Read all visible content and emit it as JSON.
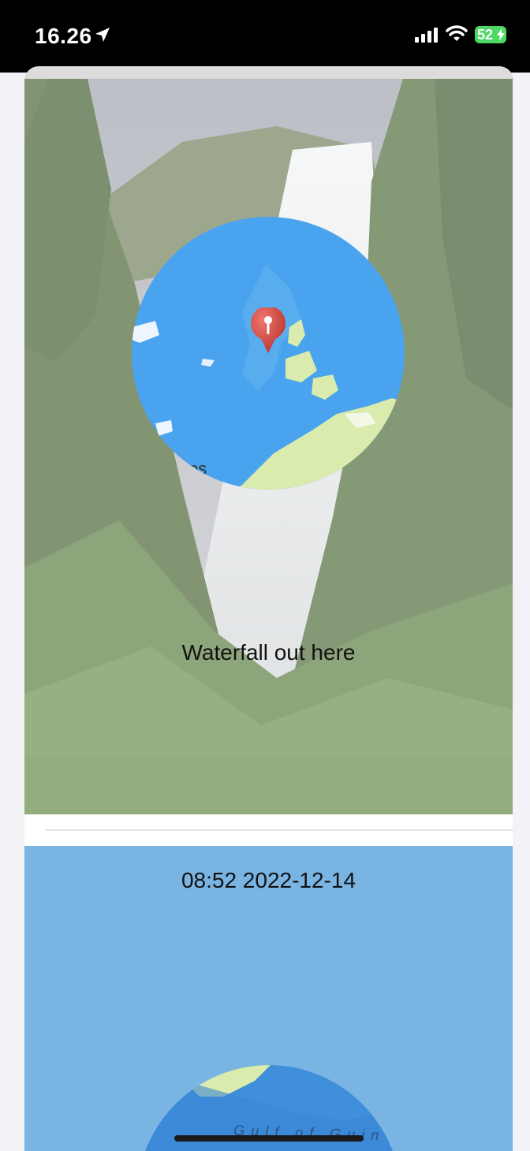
{
  "status_bar": {
    "time": "16.26",
    "battery": "52",
    "icons": [
      "location-arrow-icon",
      "signal-bars-icon",
      "wifi-icon",
      "battery-charging-icon"
    ]
  },
  "post1": {
    "caption": "Waterfall out here",
    "map_label_fragment": "ps"
  },
  "post2": {
    "timestamp": "08:52 2022-12-14",
    "map_label": "Gulf of Guin"
  },
  "colors": {
    "status_bar_bg": "#000000",
    "map_water": "#4aa3ee",
    "map_land": "#d9ebad",
    "pin": "#d2403a",
    "card2_bg": "#7ab4e3",
    "battery": "#4cd964"
  }
}
